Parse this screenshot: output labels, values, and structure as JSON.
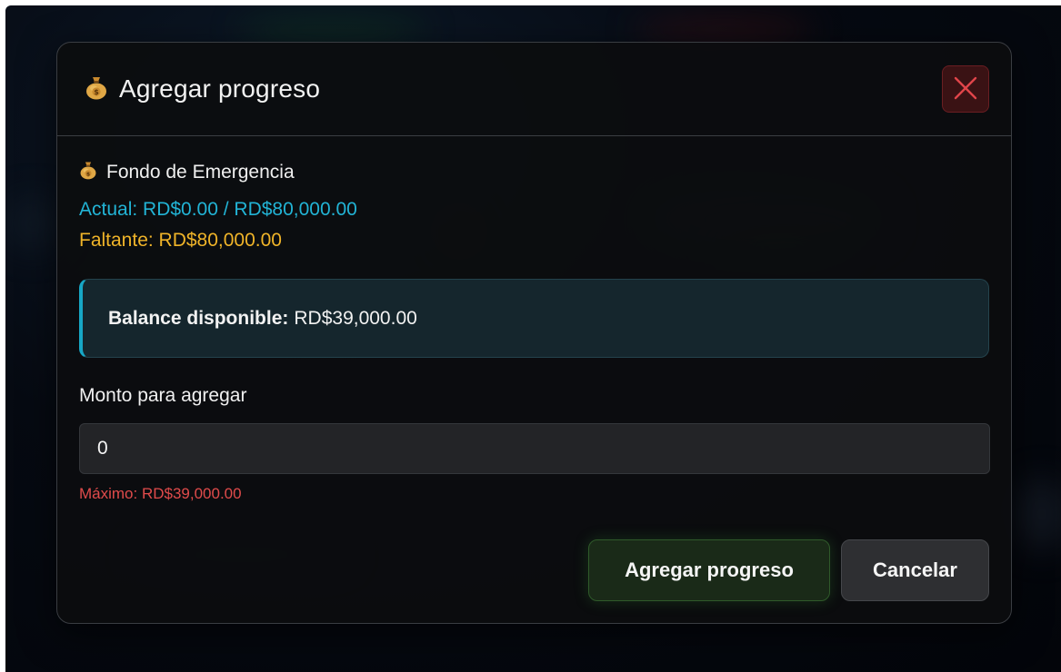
{
  "modal": {
    "title": "Agregar progreso",
    "title_icon": "money-bag-icon",
    "close_icon": "close-icon"
  },
  "goal": {
    "icon": "money-bag-icon",
    "name": "Fondo de Emergencia",
    "actual_text": "Actual: RD$0.00 / RD$80,000.00",
    "faltante_text": "Faltante: RD$80,000.00"
  },
  "balance": {
    "label": "Balance disponible:",
    "value": "RD$39,000.00"
  },
  "form": {
    "amount_label": "Monto para agregar",
    "amount_value": "0",
    "max_hint": "Máximo: RD$39,000.00"
  },
  "actions": {
    "submit_label": "Agregar progreso",
    "cancel_label": "Cancelar"
  },
  "colors": {
    "accent_cyan": "#22b4d6",
    "accent_amber": "#f0b429",
    "error_red": "#e04b4b",
    "primary_green": "#2f5a2a",
    "close_red": "#e0454a"
  }
}
